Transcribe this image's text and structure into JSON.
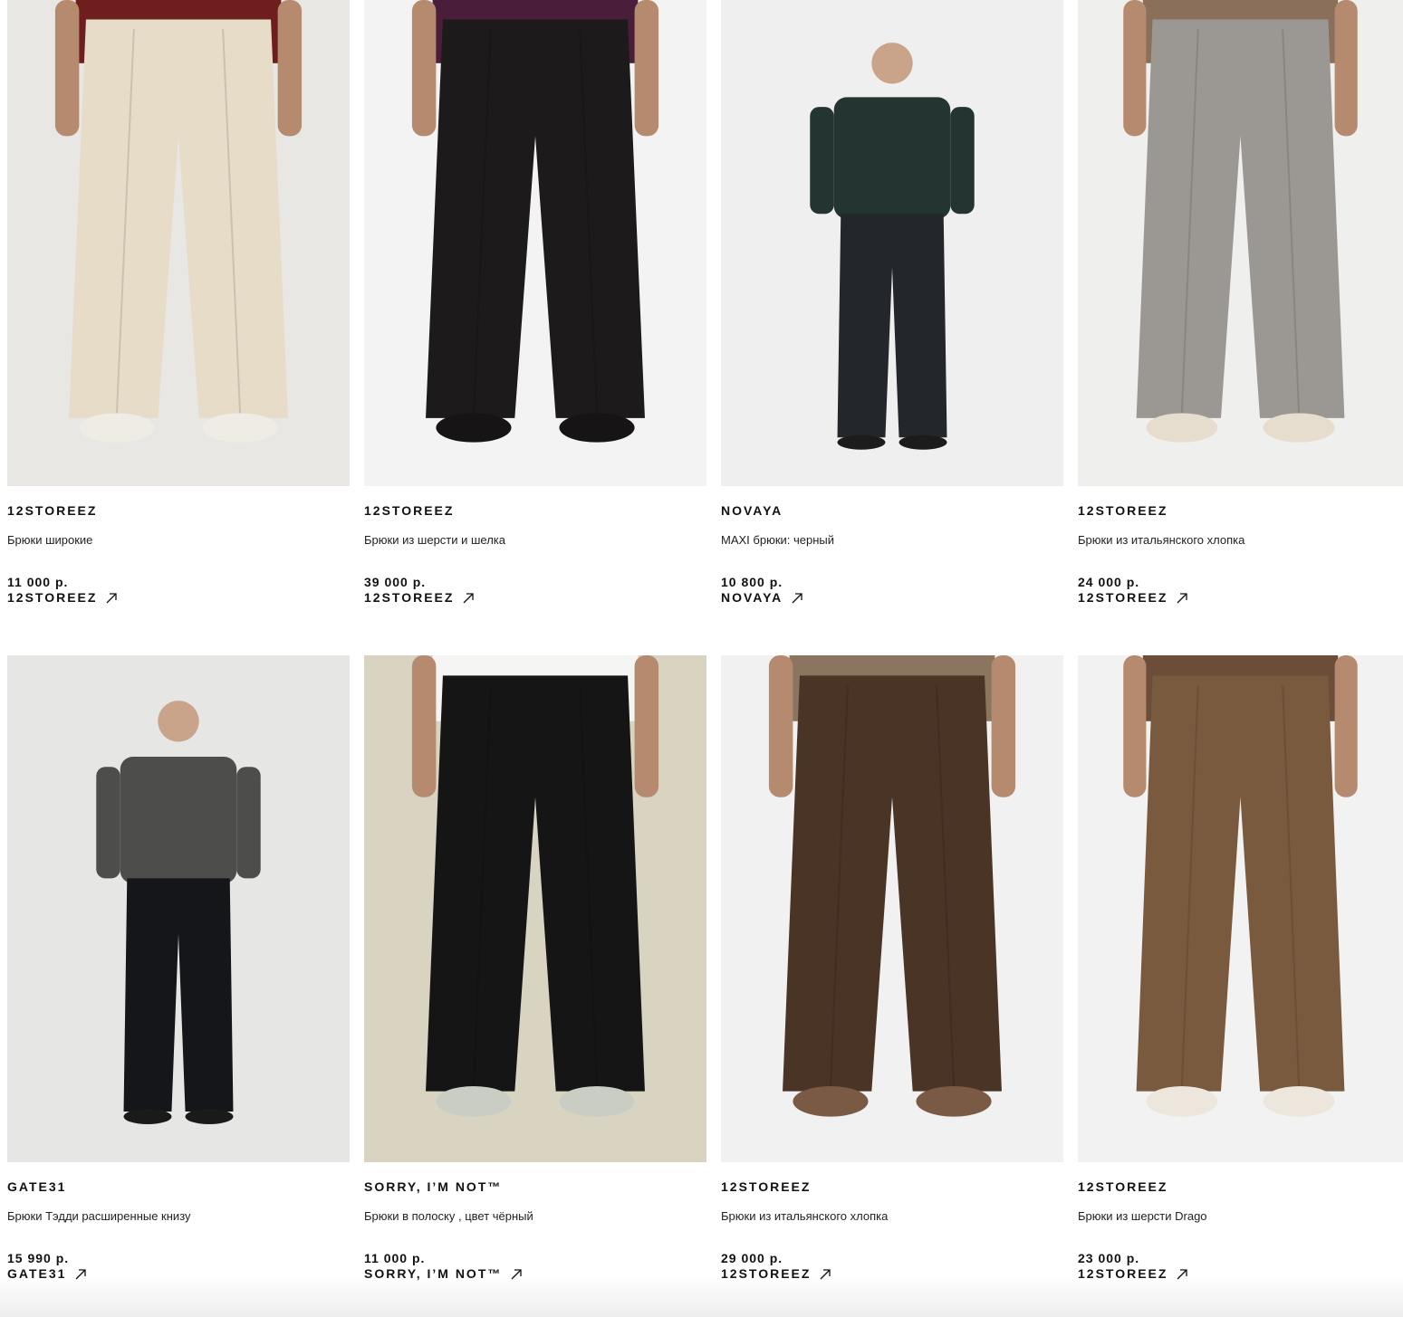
{
  "products": [
    {
      "brand": "12STOREEZ",
      "title": "Брюки широкие",
      "price": "11 000 р.",
      "shop": "12STOREEZ",
      "bg": "#e9e7e4",
      "pants": "#e6dcc8",
      "top": "#6e1e1c",
      "shoes": "#efece6",
      "photo_name": "wide-cream-trousers-photo"
    },
    {
      "brand": "12STOREEZ",
      "title": "Брюки из шерсти и шелка",
      "price": "39 000 р.",
      "shop": "12STOREEZ",
      "bg": "#f3f3f3",
      "pants": "#1c1a1a",
      "top": "#4a1e3a",
      "shoes": "#161414",
      "photo_name": "black-wool-silk-trousers-photo"
    },
    {
      "brand": "NOVAYA",
      "title": "MAXI брюки: черный",
      "price": "10 800 р.",
      "shop": "NOVAYA",
      "bg": "#efefef",
      "pants": "#23262a",
      "top": "#233431",
      "shoes": "#1c1c1c",
      "photo_name": "maxi-black-trousers-photo"
    },
    {
      "brand": "12STOREEZ",
      "title": "Брюки из итальянского хлопка",
      "price": "24 000 р.",
      "shop": "12STOREEZ",
      "bg": "#efefee",
      "pants": "#9b9894",
      "top": "#8a6f5a",
      "shoes": "#e6ddcf",
      "photo_name": "grey-cotton-trousers-photo"
    },
    {
      "brand": "GATE31",
      "title": "Брюки Тэдди расширенные книзу",
      "price": "15 990 р.",
      "shop": "GATE31",
      "bg": "#e6e6e4",
      "pants": "#15161a",
      "top": "#4d4d4b",
      "shoes": "#1a1a1a",
      "photo_name": "teddy-flared-trousers-photo"
    },
    {
      "brand": "SORRY, I’M NOT™",
      "title": "Брюки в полоску , цвет чёрный",
      "price": "11 000 р.",
      "shop": "SORRY, I’M NOT™",
      "bg": "#d9d3c2",
      "pants": "#151515",
      "top": "#f5f5f3",
      "shoes": "#c9cdc4",
      "photo_name": "pinstripe-black-trousers-photo"
    },
    {
      "brand": "12STOREEZ",
      "title": "Брюки из итальянского хлопка",
      "price": "29 000 р.",
      "shop": "12STOREEZ",
      "bg": "#f1f1f1",
      "pants": "#4a3426",
      "top": "#8c7560",
      "shoes": "#7a5a44",
      "photo_name": "brown-cotton-trousers-photo"
    },
    {
      "brand": "12STOREEZ",
      "title": "Брюки из шерсти Drago",
      "price": "23 000 р.",
      "shop": "12STOREEZ",
      "bg": "#f2f2f2",
      "pants": "#7a5a3e",
      "top": "#6b4d3a",
      "shoes": "#ece6dc",
      "photo_name": "drago-wool-trousers-photo"
    }
  ]
}
